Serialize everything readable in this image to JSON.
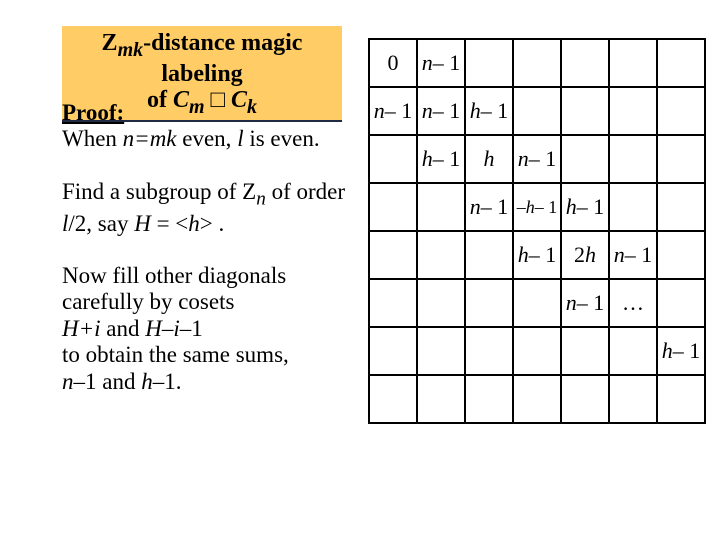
{
  "title": {
    "line1_a": "Z",
    "line1_sub": "mk",
    "line1_b": "-distance magic labeling",
    "line2_a": "of ",
    "line2_b": "C",
    "line2_c": "m",
    "line2_d": " □ ",
    "line2_e": "C",
    "line2_f": "k"
  },
  "proof": {
    "label": "Proof:",
    "p1_a": "When ",
    "p1_b": "n=mk",
    "p1_c": " even, ",
    "p1_d": "l",
    "p1_e": " is even.",
    "p2_a": "Find a subgroup of  ",
    "p2_b": "Z",
    "p2_c": "n",
    "p2_d": " of order ",
    "p2_e": "l",
    "p2_f": "/2, say ",
    "p2_g": "H",
    "p2_h": " = <",
    "p2_i": "h",
    "p2_j": "> .",
    "p3_a": "Now fill other diagonals carefully by cosets",
    "p3_b": "H+i",
    "p3_c": " and  ",
    "p3_d": "H–i–",
    "p3_e": "1",
    "p3_f": "to obtain the same sums,",
    "p3_g": "n–",
    "p3_h": "1 and ",
    "p3_i": "h–",
    "p3_j": "1."
  },
  "table": {
    "r0c0": "0",
    "nm1_n": "n",
    "nm1_suf": "– 1",
    "hm1_h": "h",
    "hm1_suf": "– 1",
    "h": "h",
    "mhm1_pre": "–",
    "mhm1_h": "h",
    "mhm1_suf": "– 1",
    "twoh_a": "2",
    "twoh_b": "h",
    "dots": "…"
  }
}
